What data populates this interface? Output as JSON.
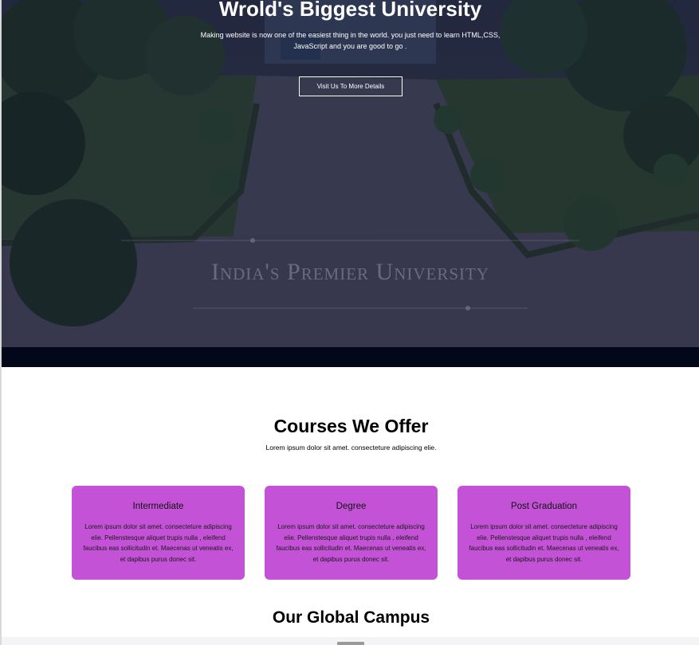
{
  "hero": {
    "title": "Wrold's Biggest University",
    "subtitle": "Making website is now one of the easiest thing in the world. you just need to learn HTML,CSS, JavaScript and you are good to go .",
    "button_label": "Visit Us To More Details",
    "watermark": "India's Premier University"
  },
  "courses": {
    "heading": "Courses We Offer",
    "subtitle": "Lorem ipsum dolor sit amet. consecteture adipiscing elie.",
    "card_color": "#c352d6",
    "cards": [
      {
        "title": "Intermediate",
        "text": "Lorem ipsum dolor sit amet. consecteture adipiscing elie. Pellenstesque aliquet trupis nulla , eleifend faucibus eas sollicitudin et. Maecenas ut veneatis ex, et dapibus purus donec sit."
      },
      {
        "title": "Degree",
        "text": "Lorem ipsum dolor sit amet. consecteture adipiscing elie. Pellenstesque aliquet trupis nulla , eleifend faucibus eas sollicitudin et. Maecenas ut veneatis ex, et dapibus purus donec sit."
      },
      {
        "title": "Post Graduation",
        "text": "Lorem ipsum dolor sit amet. consecteture adipiscing elie. Pellenstesque aliquet trupis nulla , eleifend faucibus eas sollicitudin et. Maecenas ut veneatis ex, et dapibus purus donec sit."
      }
    ]
  },
  "campus": {
    "heading": "Our Global Campus"
  }
}
